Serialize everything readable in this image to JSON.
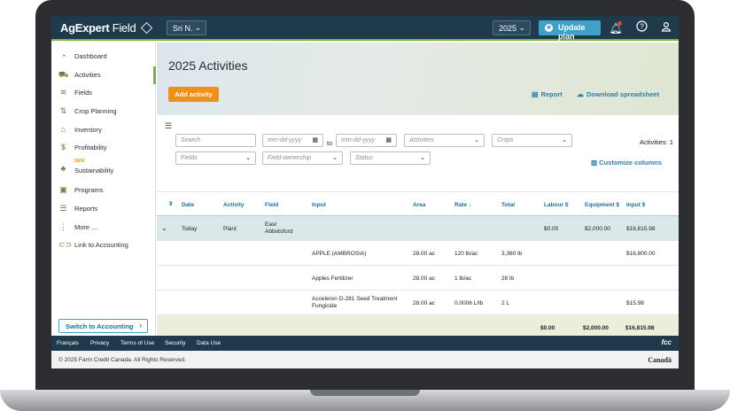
{
  "app": {
    "logo_bold": "AgExpert",
    "logo_field": "Field"
  },
  "topbar": {
    "user": "Sri N.",
    "year": "2025",
    "update_plan": "Update plan"
  },
  "sidebar": {
    "items": [
      {
        "label": "Dashboard",
        "icon": "dashboard-icon"
      },
      {
        "label": "Activities",
        "icon": "tractor-icon"
      },
      {
        "label": "Fields",
        "icon": "fields-icon"
      },
      {
        "label": "Crop Planning",
        "icon": "crop-planning-icon"
      },
      {
        "label": "Inventory",
        "icon": "inventory-icon"
      },
      {
        "label": "Profitability",
        "icon": "dollar-icon"
      },
      {
        "label": "Sustainability",
        "icon": "sprout-icon",
        "badge": "NEW"
      },
      {
        "label": "Programs",
        "icon": "programs-icon"
      },
      {
        "label": "Reports",
        "icon": "reports-icon"
      },
      {
        "label": "More ...",
        "icon": "more-icon"
      },
      {
        "label": "Link to Accounting",
        "icon": "link-icon"
      }
    ],
    "switch_label": "Switch to Accounting"
  },
  "main": {
    "title": "2025 Activities",
    "add_activity": "Add activity",
    "report": "Report",
    "download": "Download spreadsheet",
    "customize": "Customize columns",
    "activities_count": "Activities: 1"
  },
  "filters": {
    "search": "Search",
    "date_from": "mm-dd-yyyy",
    "to": "to",
    "date_to": "mm-dd-yyyy",
    "activities": "Activities",
    "crops": "Crops",
    "fields": "Fields",
    "field_ownership": "Field ownership",
    "status": "Status"
  },
  "table": {
    "headers": [
      "Date",
      "Activity",
      "Field",
      "Input",
      "Area",
      "Rate",
      "Total",
      "Labour $",
      "Equipment $",
      "Input $"
    ],
    "group": {
      "date": "Today",
      "activity": "Plant",
      "field": "East Abbotsford",
      "labour": "$0.00",
      "equipment": "$2,000.00",
      "input_cost": "$16,815.98"
    },
    "rows": [
      {
        "input": "APPLE (AMBROSIA)",
        "area": "28.00 ac",
        "rate": "120 lb/ac",
        "total": "3,360 lb",
        "input_cost": "$16,800.00"
      },
      {
        "input": "Apples Fertilizer",
        "area": "28.00 ac",
        "rate": "1 lb/ac",
        "total": "28 lb",
        "input_cost": ""
      },
      {
        "input": "Acceleron D-281 Seed Treatment Fungicide",
        "area": "28.00 ac",
        "rate": "0.0006 L/lb",
        "total": "2 L",
        "input_cost": "$15.98"
      }
    ],
    "totals": {
      "labour": "$0.00",
      "equipment": "$2,000.00",
      "input_cost": "$16,815.98"
    }
  },
  "footer": {
    "links": [
      "Français",
      "Privacy",
      "Terms of Use",
      "Security",
      "Data Use"
    ],
    "copyright": "© 2025 Farm Credit Canada. All Rights Reserved.",
    "canada": "Canadä",
    "fcc": "fcc"
  }
}
